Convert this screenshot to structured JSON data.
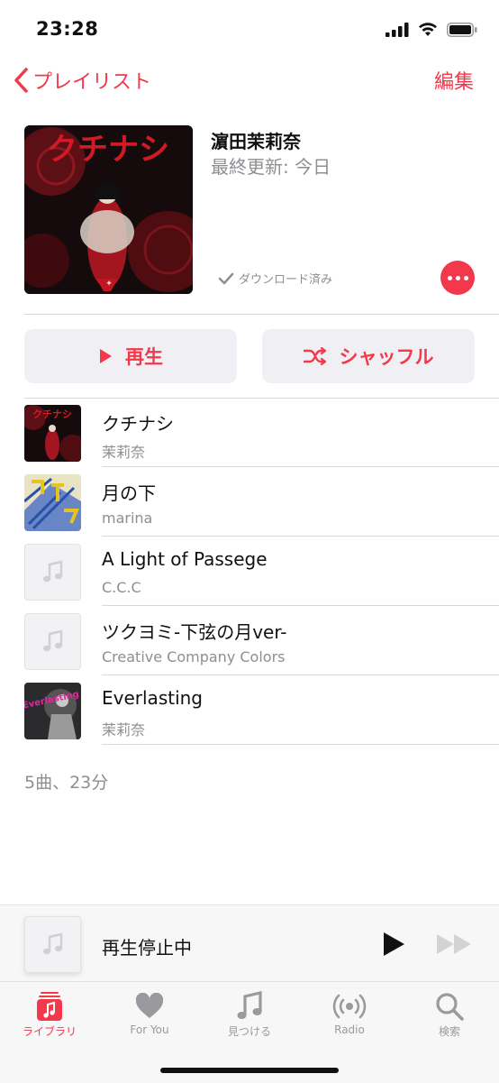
{
  "status_bar": {
    "time": "23:28"
  },
  "nav": {
    "back_label": "プレイリスト",
    "edit_label": "編集"
  },
  "playlist": {
    "title": "濵田茉莉奈",
    "subtitle": "最終更新: 今日",
    "download_status": "ダウンロード済み",
    "artwork_text": "クチナシ"
  },
  "actions": {
    "play_label": "再生",
    "shuffle_label": "シャッフル"
  },
  "tracks": [
    {
      "title": "クチナシ",
      "artist": "茉莉奈",
      "artwork": "dark-red-cover"
    },
    {
      "title": "月の下",
      "artist": "marina",
      "artwork": "blue-yellow-cover"
    },
    {
      "title": "A Light of Passege",
      "artist": "C.C.C",
      "artwork": "music-note-placeholder"
    },
    {
      "title": "ツクヨミ-下弦の月ver-",
      "artist": "Creative Company Colors",
      "artwork": "music-note-placeholder"
    },
    {
      "title": "Everlasting",
      "artist": "茉莉奈",
      "artwork": "everlasting-cover"
    }
  ],
  "summary": "5曲、23分",
  "mini_player": {
    "label": "再生停止中"
  },
  "tabs": [
    {
      "label": "ライブラリ",
      "icon": "library-icon",
      "active": true
    },
    {
      "label": "For You",
      "icon": "heart-icon",
      "active": false
    },
    {
      "label": "見つける",
      "icon": "music-note-icon",
      "active": false
    },
    {
      "label": "Radio",
      "icon": "radio-icon",
      "active": false
    },
    {
      "label": "検索",
      "icon": "search-icon",
      "active": false
    }
  ],
  "colors": {
    "accent": "#f4384b",
    "secondary_text": "#8e8e93",
    "button_bg": "#efeff4"
  }
}
